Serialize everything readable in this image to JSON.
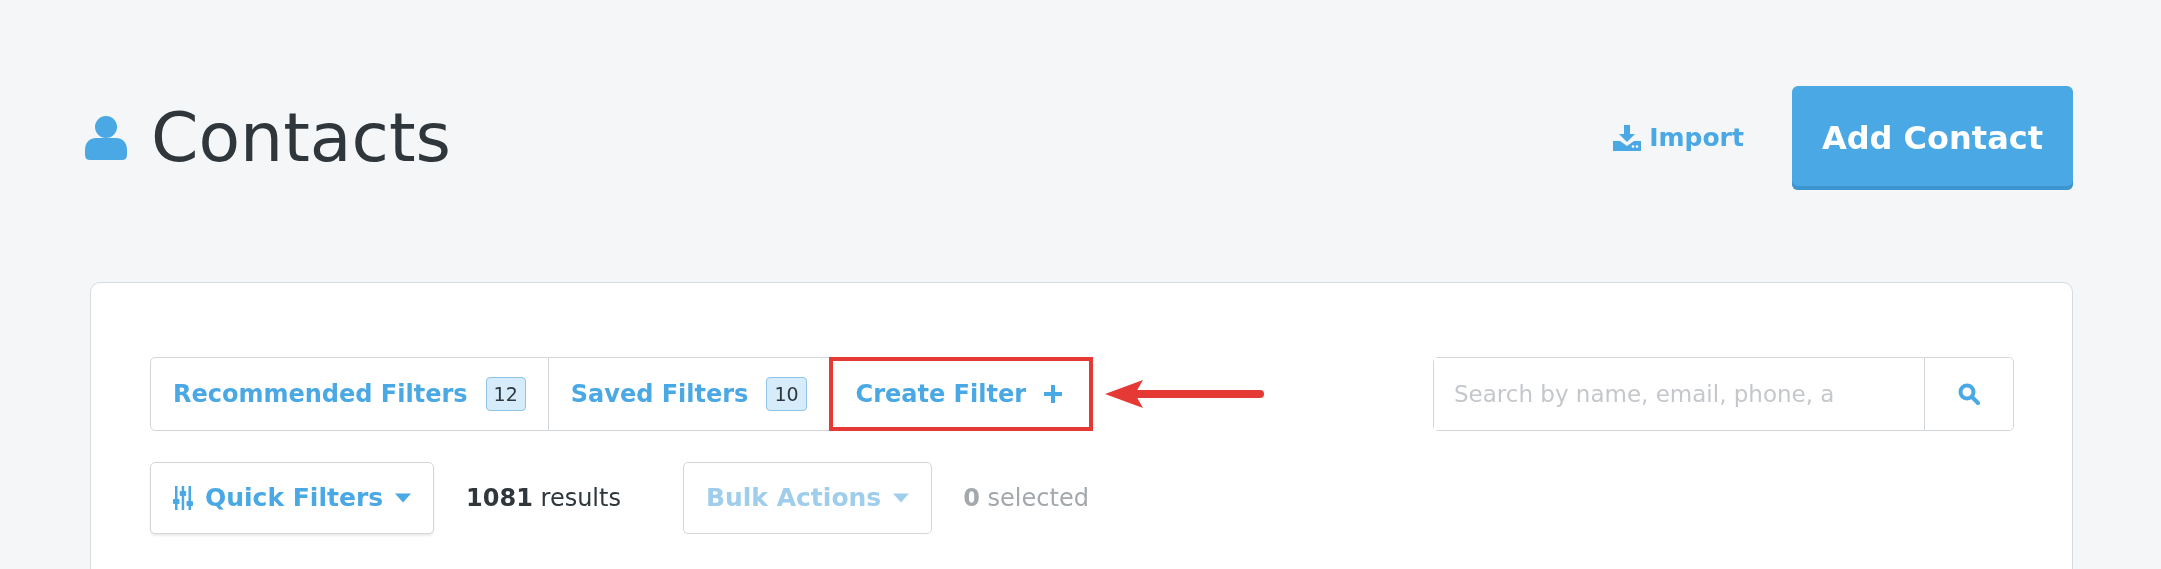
{
  "header": {
    "title": "Contacts",
    "import_label": "Import",
    "add_button": "Add Contact"
  },
  "filter_tabs": [
    {
      "label": "Recommended Filters",
      "count": "12",
      "kind": "count",
      "highlighted": false
    },
    {
      "label": "Saved Filters",
      "count": "10",
      "kind": "count",
      "highlighted": false
    },
    {
      "label": "Create Filter",
      "kind": "create",
      "highlighted": true
    }
  ],
  "search": {
    "placeholder": "Search by name, email, phone, a"
  },
  "toolbar": {
    "quick_filters": "Quick Filters",
    "results_count": "1081",
    "results_label": "results",
    "bulk_actions": "Bulk Actions",
    "bulk_disabled": true,
    "selected_count": "0",
    "selected_label": "selected"
  }
}
